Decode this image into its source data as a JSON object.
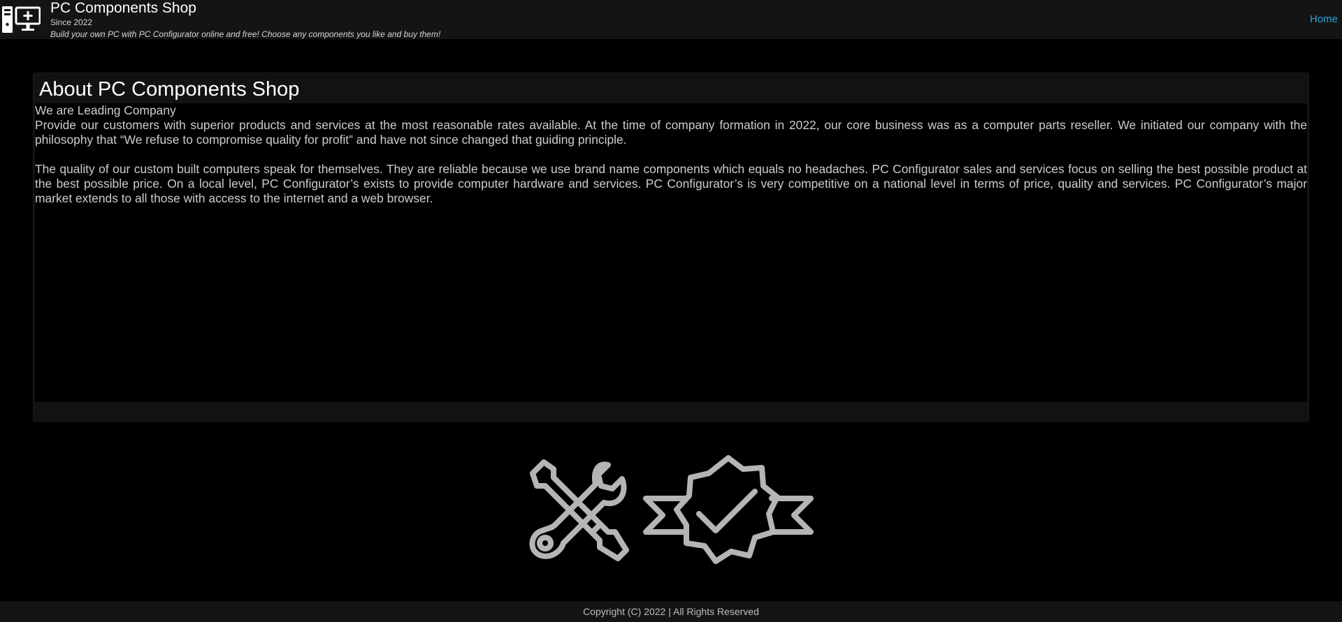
{
  "header": {
    "title": "PC Components Shop",
    "since": "Since 2022",
    "tagline": "Build your own PC with PC Configurator online and free! Choose any components you like and buy them!",
    "logo_icon": "pc-configurator-logo-icon",
    "nav": {
      "home_label": "Home"
    }
  },
  "about": {
    "title": "About PC Components Shop",
    "subtitle": "We are Leading Company",
    "paragraphs": [
      "Provide our customers with superior products and services at the most reasonable rates available. At the time of company formation in 2022, our core business was as a computer parts reseller. We initiated our company with the philosophy that “We refuse to compromise quality for profit” and have not since changed that guiding principle.",
      "The quality of our custom built computers speak for themselves. They are reliable because we use brand name components which equals no headaches. PC Configurator sales and services focus on selling the best possible product at the best possible price. On a local level, PC Configurator’s exists to provide computer hardware and services. PC Configurator’s is very competitive on a national level in terms of price, quality and services. PC Configurator’s major market extends to all those with access to the internet and a web browser."
    ]
  },
  "badges": [
    {
      "icon": "wrench-screwdriver-icon"
    },
    {
      "icon": "quality-check-badge-icon"
    }
  ],
  "footer": {
    "copyright": "Copyright (C) 2022 | All Rights Reserved"
  },
  "colors": {
    "background": "#000000",
    "header_bg": "#141414",
    "panel_bg": "#121212",
    "link": "#2aa3d4",
    "icon_gray": "#b5b5b5"
  }
}
